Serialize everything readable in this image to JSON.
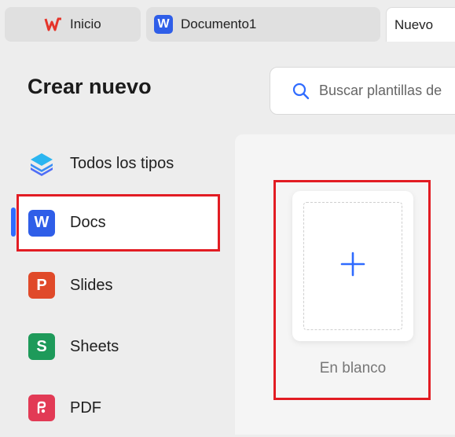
{
  "tabs": [
    {
      "label": "Inicio",
      "icon": "wps-logo-icon"
    },
    {
      "label": "Documento1",
      "icon": "word-doc-icon"
    },
    {
      "label": "Nuevo"
    }
  ],
  "page_title": "Crear nuevo",
  "search": {
    "placeholder": "Buscar plantillas de"
  },
  "nav": [
    {
      "label": "Todos los tipos",
      "icon": "layers-icon"
    },
    {
      "label": "Docs",
      "icon": "docs-icon",
      "badge": "W",
      "color": "#2f5ee8",
      "active": true
    },
    {
      "label": "Slides",
      "icon": "slides-icon",
      "badge": "P",
      "color": "#e04a2a"
    },
    {
      "label": "Sheets",
      "icon": "sheets-icon",
      "badge": "S",
      "color": "#1e9a5a"
    },
    {
      "label": "PDF",
      "icon": "pdf-icon",
      "color": "#e23a55"
    }
  ],
  "template_card": {
    "label": "En blanco"
  },
  "colors": {
    "accent": "#2f6bff",
    "highlight": "#e21c23"
  }
}
